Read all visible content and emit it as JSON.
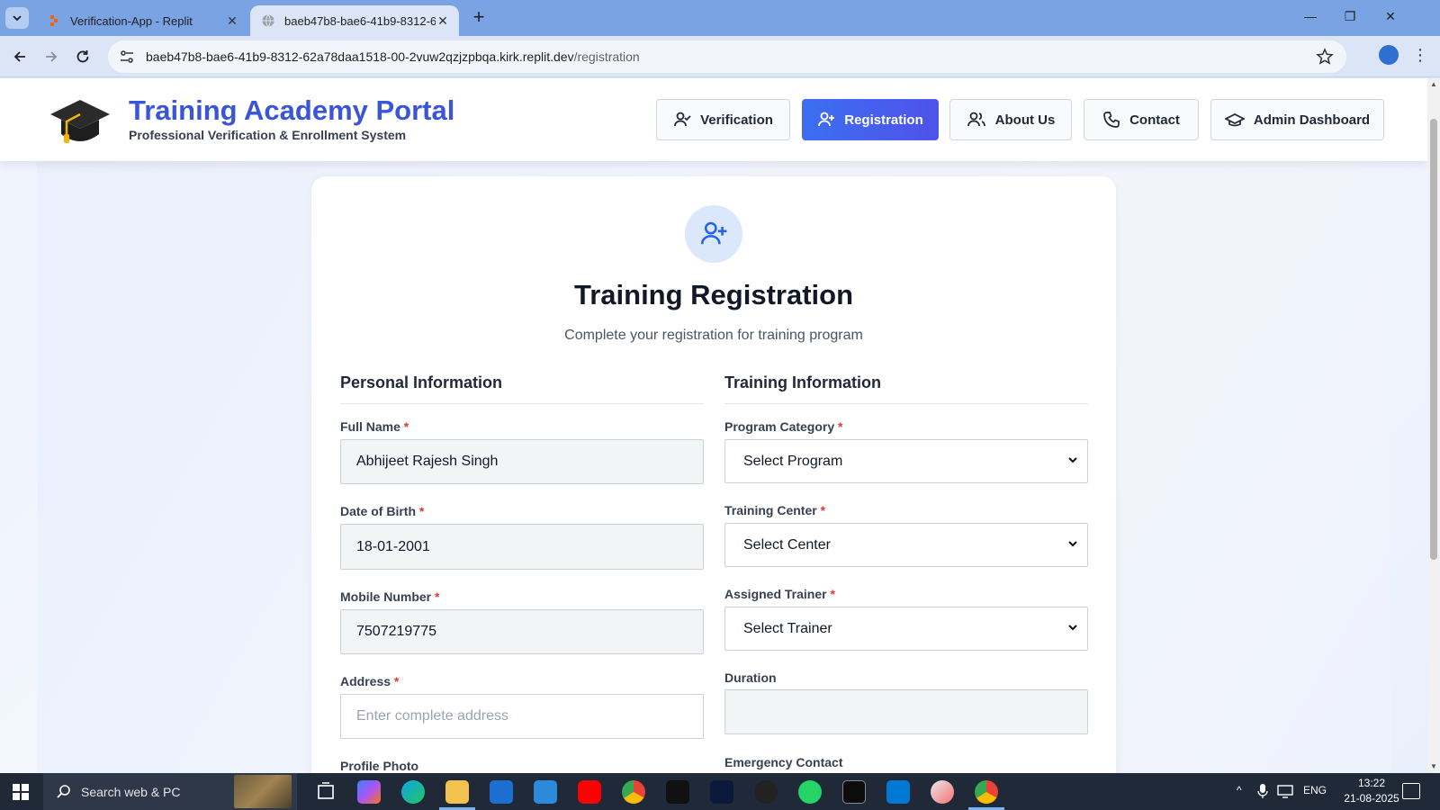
{
  "browser": {
    "tabs": [
      {
        "title": "Verification-App - Replit",
        "active": false
      },
      {
        "title": "baeb47b8-bae6-41b9-8312-62a78daa1518-00-2vuw2qzjzpbqa.kirk.replit.dev",
        "active": true
      }
    ],
    "new_tab_label": "+",
    "url_main": "baeb47b8-bae6-41b9-8312-62a78daa1518-00-2vuw2qzjzpbqa.kirk.replit.dev",
    "url_path": "/registration"
  },
  "header": {
    "title": "Training Academy Portal",
    "subtitle": "Professional Verification & Enrollment System",
    "nav": [
      {
        "label": "Verification",
        "icon": "user-check-icon",
        "active": false
      },
      {
        "label": "Registration",
        "icon": "user-plus-icon",
        "active": true
      },
      {
        "label": "About Us",
        "icon": "users-icon",
        "active": false
      },
      {
        "label": "Contact",
        "icon": "phone-icon",
        "active": false
      },
      {
        "label": "Admin Dashboard",
        "icon": "graduation-cap-icon",
        "active": false
      }
    ]
  },
  "form": {
    "title": "Training Registration",
    "subtitle": "Complete your registration for training program",
    "personal": {
      "heading": "Personal Information",
      "full_name_label": "Full Name",
      "full_name_value": "Abhijeet Rajesh Singh",
      "dob_label": "Date of Birth",
      "dob_value": "18-01-2001",
      "mobile_label": "Mobile Number",
      "mobile_value": "7507219775",
      "address_label": "Address",
      "address_placeholder": "Enter complete address",
      "photo_label": "Profile Photo"
    },
    "training": {
      "heading": "Training Information",
      "program_label": "Program Category",
      "program_value": "Select Program",
      "center_label": "Training Center",
      "center_value": "Select Center",
      "trainer_label": "Assigned Trainer",
      "trainer_value": "Select Trainer",
      "duration_label": "Duration",
      "duration_value": "",
      "emergency_label": "Emergency Contact"
    },
    "required_mark": "*"
  },
  "taskbar": {
    "search_placeholder": "Search web & PC",
    "language": "ENG",
    "time": "13:22",
    "date": "21-08-2025"
  },
  "colors": {
    "brand": "#3b55d9",
    "accent_active": "#4f52ea",
    "required": "#e53935"
  }
}
